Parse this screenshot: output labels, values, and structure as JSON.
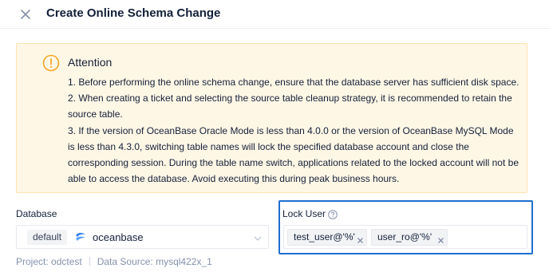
{
  "dialog": {
    "title": "Create Online Schema Change",
    "close_icon": "close-icon"
  },
  "notice": {
    "icon": "warning-circle-icon",
    "title": "Attention",
    "lines": [
      "1. Before performing the online schema change, ensure that the database server has sufficient disk space.",
      "2. When creating a ticket and selecting the source table cleanup strategy, it is recommended to retain the source table.",
      "3. If the version of OceanBase Oracle Mode is less than 4.0.0 or the version of OceanBase MySQL Mode is less than 4.3.0, switching table names will lock the specified database account and close the corresponding session. During the table name switch, applications related to the locked account will not be able to access the database. Avoid executing this during peak business hours."
    ],
    "colors": {
      "background": "#fff7e6",
      "border": "#ffe3b0",
      "icon": "#f5a623"
    }
  },
  "database": {
    "label": "Database",
    "environment_tag": "default",
    "db_icon": "oceanbase-icon",
    "value": "oceanbase",
    "chevron_icon": "chevron-down-icon",
    "project": "Project: odctest",
    "data_source": "Data Source: mysql422x_1"
  },
  "lock_user": {
    "label": "Lock User",
    "help_icon": "question-circle-icon",
    "tags": [
      "test_user@'%'",
      "user_ro@'%'"
    ],
    "remove_icon": "close-icon",
    "highlight_color": "#1f6fd1"
  }
}
